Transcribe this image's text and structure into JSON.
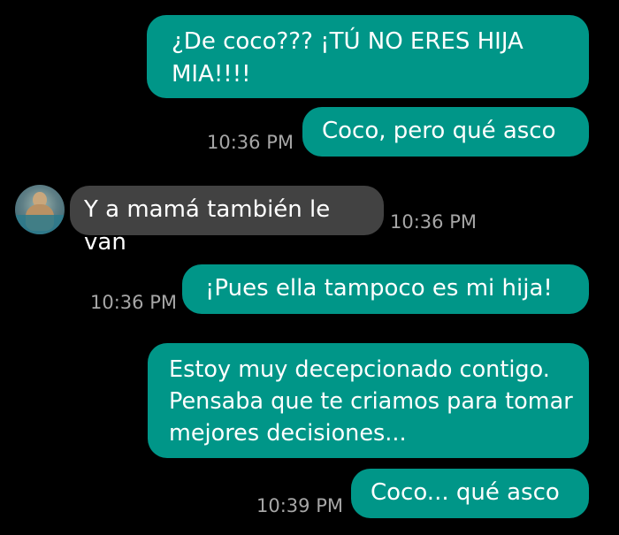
{
  "messages": [
    {
      "direction": "outgoing",
      "text": "¿De coco??? ¡TÚ NO ERES HIJA MIA!!!!",
      "time": ""
    },
    {
      "direction": "outgoing",
      "text": "Coco, pero qué asco",
      "time": "10:36 PM"
    },
    {
      "direction": "incoming",
      "text": "Y a mamá también le van",
      "time": "10:36 PM"
    },
    {
      "direction": "outgoing",
      "text": "¡Pues ella tampoco es mi hija!",
      "time": "10:36 PM"
    },
    {
      "direction": "outgoing",
      "text": "Estoy muy decepcionado contigo. Pensaba que te criamos para tomar mejores decisiones...",
      "time": ""
    },
    {
      "direction": "outgoing",
      "text": "Coco... qué asco",
      "time": "10:39 PM"
    }
  ],
  "colors": {
    "background": "#000000",
    "outgoing_bubble": "#009688",
    "incoming_bubble": "#424242",
    "message_text": "#ffffff",
    "timestamp_text": "#a6a6a6"
  },
  "icons": {
    "contact_avatar": "contact-avatar-photo"
  }
}
